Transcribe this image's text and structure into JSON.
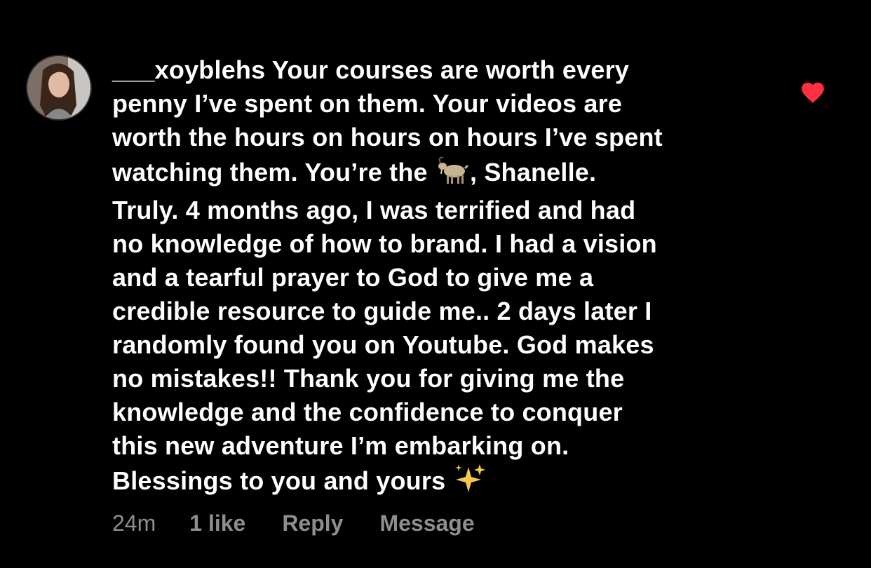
{
  "comment": {
    "username": "___xoyblehs",
    "lines": [
      " Your courses are worth every",
      "penny I’ve spent on them. Your videos are",
      "worth the hours on hours on hours I’ve spent",
      "watching them. You’re the ",
      ", Shanelle.",
      "Truly. 4 months ago, I was terrified and had",
      "no knowledge of how to brand. I had a vision",
      "and a tearful prayer to God to give me a",
      "credible resource to guide me.. 2 days later I",
      "randomly found you on Youtube. God makes",
      "no mistakes!! Thank you for giving me the",
      "knowledge and the confidence to conquer",
      "this new adventure I’m embarking on.",
      "Blessings to you and yours "
    ],
    "emojis": {
      "goat": "goat-emoji",
      "sparkles": "sparkles-emoji"
    }
  },
  "meta": {
    "time": "24m",
    "likes": "1 like",
    "reply": "Reply",
    "message": "Message"
  },
  "colors": {
    "background": "#000000",
    "text": "#ffffff",
    "meta_text": "#8e8e8e",
    "heart": "#ff3040"
  },
  "icons": {
    "like": "heart-filled-icon",
    "avatar": "profile-photo"
  }
}
